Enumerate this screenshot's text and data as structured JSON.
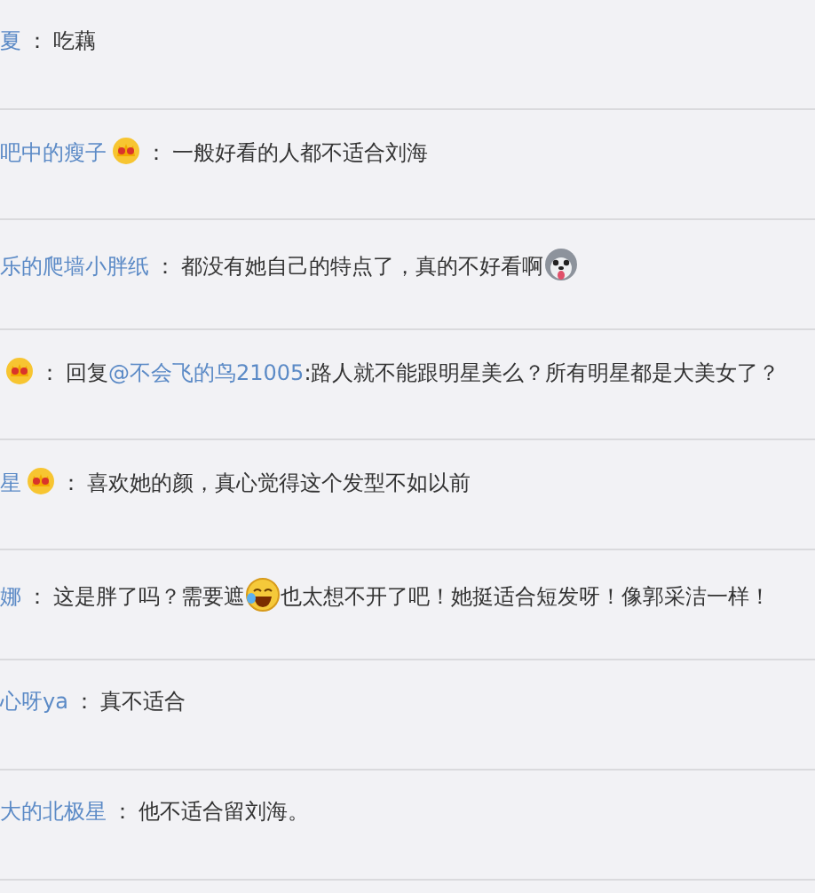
{
  "comments": [
    {
      "user": "夏",
      "crown": false,
      "separator": "：",
      "content": [
        {
          "kind": "text",
          "text": "吃藕"
        }
      ]
    },
    {
      "user": "吧中的瘦子",
      "crown": true,
      "separator": "：",
      "content": [
        {
          "kind": "text",
          "text": "一般好看的人都不适合刘海"
        }
      ]
    },
    {
      "user": "乐的爬墙小胖纸",
      "crown": false,
      "separator": "：",
      "content": [
        {
          "kind": "text",
          "text": "都没有她自己的特点了，真的不好看啊"
        },
        {
          "kind": "dog"
        }
      ]
    },
    {
      "crown": true,
      "separator": "：",
      "content": [
        {
          "kind": "text",
          "text": "回复"
        },
        {
          "kind": "mention",
          "text": "@不会飞的鸟21005"
        },
        {
          "kind": "text",
          "text": ":路人就不能跟明星美么？所有明星都是大美女了？"
        }
      ]
    },
    {
      "user": "星",
      "crown": true,
      "separator": "：",
      "content": [
        {
          "kind": "text",
          "text": "喜欢她的颜，真心觉得这个发型不如以前"
        }
      ]
    },
    {
      "user": "娜",
      "crown": false,
      "separator": "：",
      "content": [
        {
          "kind": "text",
          "text": "这是胖了吗？需要遮"
        },
        {
          "kind": "laugh"
        },
        {
          "kind": "text",
          "text": "也太想不开了吧！她挺适合短发呀！像郭采洁一样！"
        }
      ]
    },
    {
      "user": "心呀ya",
      "crown": false,
      "separator": "：",
      "content": [
        {
          "kind": "text",
          "text": "真不适合"
        }
      ]
    },
    {
      "user": "大的北极星",
      "crown": false,
      "separator": "：",
      "content": [
        {
          "kind": "text",
          "text": "他不适合留刘海。"
        }
      ]
    }
  ]
}
